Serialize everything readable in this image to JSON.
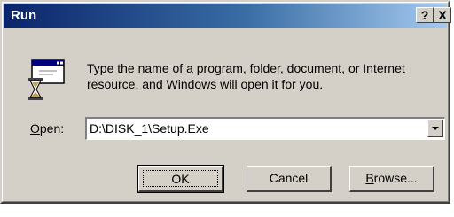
{
  "window": {
    "title": "Run",
    "help_glyph": "?",
    "close_glyph": "X"
  },
  "dialog": {
    "icon": "run-program-icon",
    "description": "Type the name of a program, folder, document, or Internet resource, and Windows will open it for you.",
    "open_label_mnemonic": "O",
    "open_label_rest": "pen:",
    "open_value": "D:\\DISK_1\\Setup.Exe"
  },
  "buttons": {
    "ok": "OK",
    "cancel": "Cancel",
    "browse_mnemonic": "B",
    "browse_rest": "rowse..."
  },
  "colors": {
    "title_gradient_start": "#0a246a",
    "title_gradient_end": "#a6caf0",
    "face": "#d4d0c8"
  }
}
